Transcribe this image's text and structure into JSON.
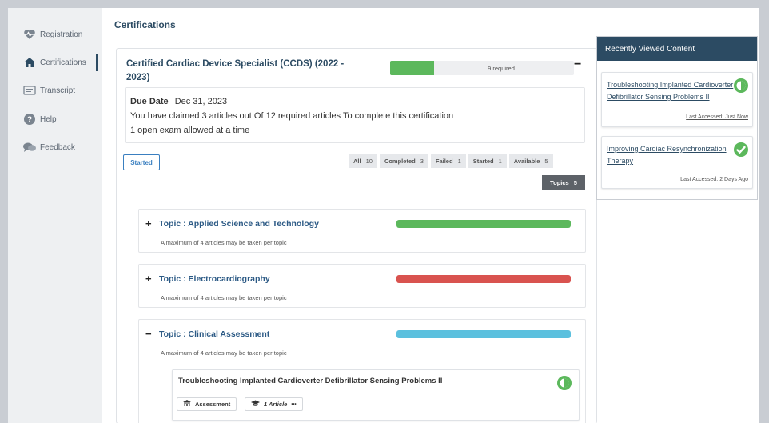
{
  "sidebar": {
    "items": [
      {
        "label": "Registration",
        "icon": "heart-pulse-icon"
      },
      {
        "label": "Certifications",
        "icon": "home-icon"
      },
      {
        "label": "Transcript",
        "icon": "document-icon"
      },
      {
        "label": "Help",
        "icon": "help-icon"
      },
      {
        "label": "Feedback",
        "icon": "chat-icon"
      }
    ],
    "active": "Certifications"
  },
  "page": {
    "title": "Certifications"
  },
  "certification": {
    "title": "Certified Cardiac Device Specialist (CCDS) (2022 - 2023)",
    "required_text": "9 required",
    "required_progress": 0.24,
    "collapse_symbol": "−",
    "due_label": "Due Date",
    "due_date": "Dec 31, 2023",
    "claimed_text": "You have claimed 3 articles out Of 12 required articles To complete this certification",
    "exam_text": "1 open exam allowed at a time"
  },
  "status_button": "Started",
  "filters": [
    {
      "label": "All",
      "count": "10"
    },
    {
      "label": "Completed",
      "count": "3"
    },
    {
      "label": "Failed",
      "count": "1"
    },
    {
      "label": "Started",
      "count": "1"
    },
    {
      "label": "Available",
      "count": "5"
    }
  ],
  "topics_button": {
    "label": "Topics",
    "count": "5"
  },
  "topics": [
    {
      "toggle": "+",
      "title": "Topic : Applied Science and Technology",
      "note": "A maximum of 4 articles may be taken per topic",
      "bar_color": "#5cb85c"
    },
    {
      "toggle": "+",
      "title": "Topic : Electrocardiography",
      "note": "A maximum of 4 articles may be taken per topic",
      "bar_color": "#d9534f"
    },
    {
      "toggle": "−",
      "title": "Topic : Clinical Assessment",
      "note": "A maximum of 4 articles may be taken per topic",
      "bar_color": "#5bc0de"
    }
  ],
  "article": {
    "title": "Troubleshooting Implanted Cardioverter Defibrillator Sensing Problems II",
    "assessment_label": "Assessment",
    "articles_label": "1 Article",
    "articles_more": "•••",
    "status_icon": "half-circle-icon"
  },
  "recently_viewed": {
    "title": "Recently Viewed Content",
    "items": [
      {
        "title": "Troubleshooting Implanted Cardioverter Defibrillator Sensing Problems II",
        "last_accessed": "Last Accessed: Just Now",
        "status_icon": "half-circle-icon"
      },
      {
        "title": "Improving Cardiac Resynchronization Therapy",
        "last_accessed": "Last Accessed: 2 Days Ago",
        "status_icon": "check-circle-icon"
      }
    ]
  },
  "colors": {
    "primary": "#2c4b63",
    "success": "#5cb85c",
    "danger": "#d9534f",
    "info": "#5bc0de"
  }
}
